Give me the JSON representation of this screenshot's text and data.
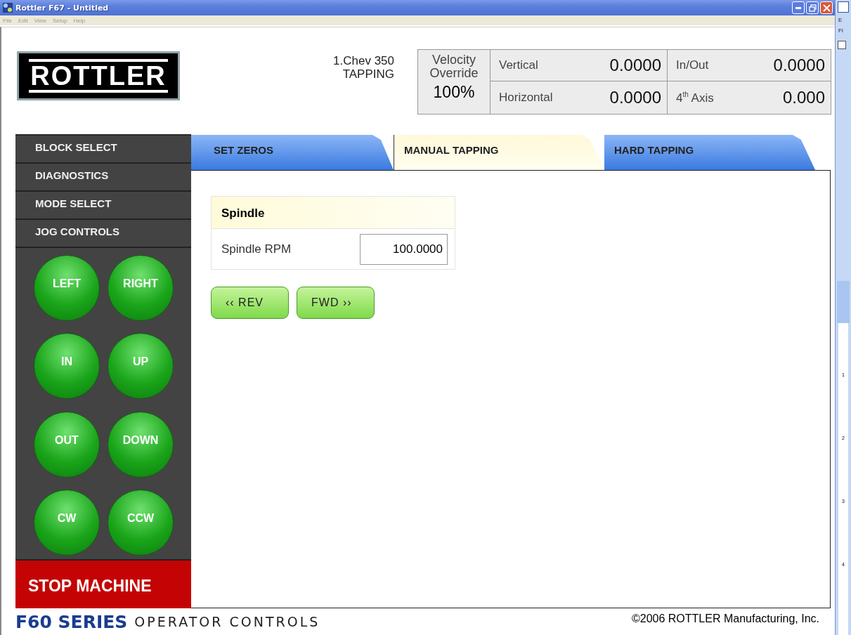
{
  "window": {
    "title": "Rottler F67 - Untitled"
  },
  "menu": [
    "File",
    "Edit",
    "View",
    "Setup",
    "Help"
  ],
  "logo": "ROTTLER",
  "job": {
    "name": "1.Chev 350",
    "mode": "TAPPING"
  },
  "velocity": {
    "label": "Velocity Override",
    "value": "100%"
  },
  "readouts": [
    {
      "label": "Vertical",
      "value": "0.0000"
    },
    {
      "label": "In/Out",
      "value": "0.0000"
    },
    {
      "label": "Horizontal",
      "value": "0.0000"
    },
    {
      "label": "4$^{th}$ Axis",
      "value": "0.000"
    }
  ],
  "sidebar": {
    "items": [
      "BLOCK SELECT",
      "DIAGNOSTICS",
      "MODE SELECT",
      "JOG CONTROLS"
    ],
    "jog_buttons": [
      "LEFT",
      "RIGHT",
      "IN",
      "UP",
      "OUT",
      "DOWN",
      "CW",
      "CCW"
    ],
    "stop_button": "STOP MACHINE"
  },
  "tabs": [
    {
      "label": "SET ZEROS",
      "selected": false
    },
    {
      "label": "MANUAL TAPPING",
      "selected": true
    },
    {
      "label": "HARD TAPPING",
      "selected": false
    }
  ],
  "spindle": {
    "title": "Spindle",
    "field_label": "Spindle RPM",
    "value": "100.0000"
  },
  "buttons": [
    "‹‹ REV",
    "FWD ››"
  ],
  "footer": {
    "series": "F60 SERIES",
    "subtitle": "OPERATOR CONTROLS",
    "copyright": "©2006 ROTTLER Manufacturing, Inc."
  },
  "background_app": {
    "toolbar_texts": [
      "E",
      "Fi"
    ],
    "ruler": [
      "1",
      "2",
      "3",
      "4"
    ]
  }
}
